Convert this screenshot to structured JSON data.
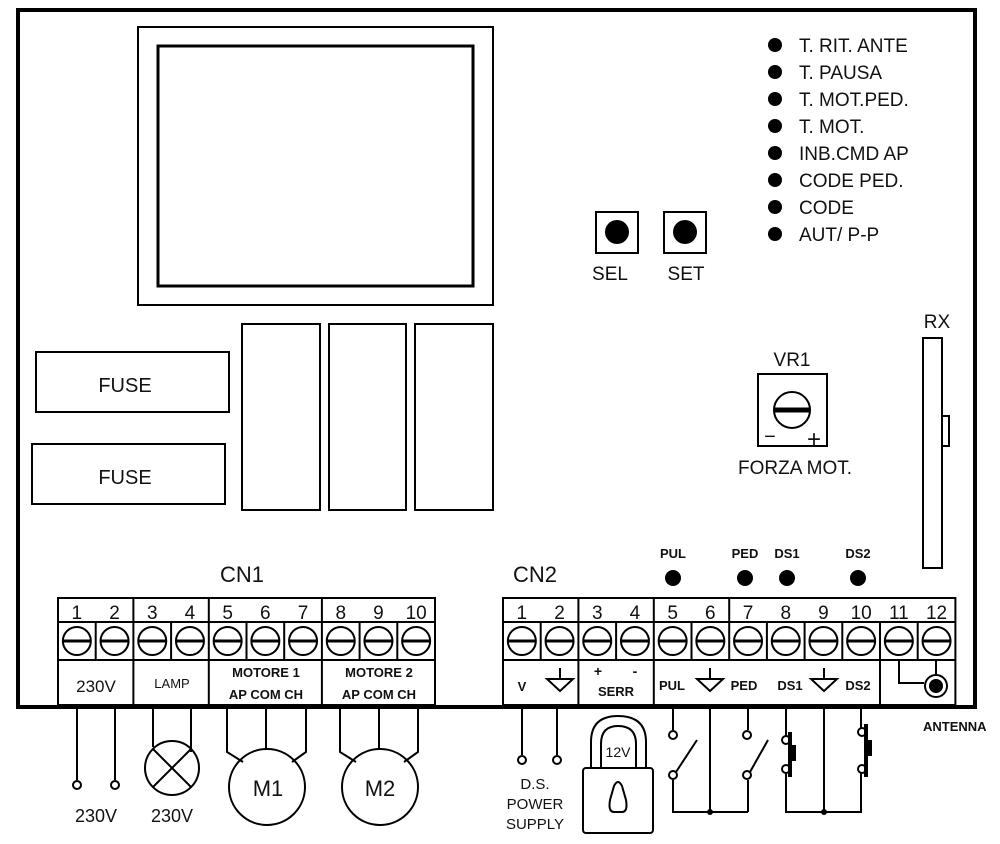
{
  "board": {
    "fuse_labels": [
      "FUSE",
      "FUSE"
    ],
    "leds": [
      "T. RIT. ANTE",
      "T. PAUSA",
      "T. MOT.PED.",
      "T. MOT.",
      "INB.CMD AP",
      "CODE  PED.",
      "CODE",
      "AUT/ P-P"
    ],
    "buttons": [
      "SEL",
      "SET"
    ],
    "trimmer": {
      "name": "VR1",
      "caption": "FORZA MOT.",
      "minus": "−",
      "plus": "+"
    },
    "receiver": "RX",
    "input_leds": [
      "PUL",
      "PED",
      "DS1",
      "DS2"
    ]
  },
  "cn1": {
    "title": "CN1",
    "numbers": [
      "1",
      "2",
      "3",
      "4",
      "5",
      "6",
      "7",
      "8",
      "9",
      "10"
    ],
    "groups": [
      "230V",
      "LAMP",
      "MOTORE 1",
      "AP COM CH",
      "MOTORE 2",
      "AP COM CH"
    ]
  },
  "cn2": {
    "title": "CN2",
    "numbers": [
      "1",
      "2",
      "3",
      "4",
      "5",
      "6",
      "7",
      "8",
      "9",
      "10",
      "11",
      "12"
    ],
    "labels": {
      "v": "V",
      "plus": "+",
      "minus": "-",
      "serr": "SERR",
      "pul": "PUL",
      "ped": "PED",
      "ds1": "DS1",
      "ds2": "DS2"
    }
  },
  "external": {
    "supply_230v": "230V",
    "lamp_230v": "230V",
    "motor1": "M1",
    "motor2": "M2",
    "ds_supply": [
      "D.S.",
      "POWER",
      "SUPPLY"
    ],
    "lock_voltage": "12V",
    "antenna": "ANTENNA"
  }
}
